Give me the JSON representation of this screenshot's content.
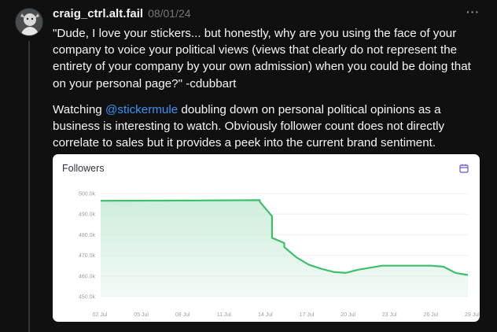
{
  "post": {
    "username": "craig_ctrl.alt.fail",
    "date": "08/01/24",
    "more_label": "···",
    "quote": "\"Dude, I love your stickers... but honestly, why are you using the face of your company to voice your political views (views that clearly do not represent the entirety of your company by your own admission) when you could be doing that on your personal page?\" -cdubbart",
    "body_prefix": "Watching ",
    "mention": "@stickermule",
    "body_suffix": " doubling down on personal political opinions as a business is interesting to watch. Obviously follower count does not directly correlate to sales but it provides a peek into the current brand sentiment."
  },
  "card": {
    "title": "Followers",
    "icon": "calendar-icon"
  },
  "colors": {
    "accent_line": "#3dbf6b",
    "area_fill": "#cfeedd",
    "mention": "#3b93f7"
  },
  "chart_data": {
    "type": "area",
    "title": "Followers",
    "xlabel": "",
    "ylabel": "",
    "x_ticks": [
      "02 Jul",
      "05 Jul",
      "08 Jul",
      "11 Jul",
      "14 Jul",
      "17 Jul",
      "20 Jul",
      "23 Jul",
      "26 Jul",
      "29 Jul"
    ],
    "y_ticks": [
      "500.0k",
      "490.0k",
      "480.0k",
      "470.0k",
      "460.0k",
      "450.0k"
    ],
    "ylim": [
      450000,
      500000
    ],
    "xlim": [
      "2024-07-01",
      "2024-07-31"
    ],
    "grid": true,
    "series": [
      {
        "x": [
          "2024-07-01",
          "2024-07-08",
          "2024-07-14",
          "2024-07-14",
          "2024-07-15",
          "2024-07-15",
          "2024-07-16",
          "2024-07-16",
          "2024-07-17",
          "2024-07-18",
          "2024-07-19",
          "2024-07-20",
          "2024-07-21",
          "2024-07-22",
          "2024-07-23",
          "2024-07-24",
          "2024-07-26",
          "2024-07-28",
          "2024-07-29",
          "2024-07-30",
          "2024-07-31"
        ],
        "values": [
          496500,
          496600,
          496800,
          496000,
          489000,
          478500,
          476000,
          474000,
          469000,
          465500,
          463500,
          462000,
          461500,
          463000,
          464000,
          465000,
          465000,
          465000,
          464500,
          461500,
          460500
        ]
      }
    ]
  }
}
